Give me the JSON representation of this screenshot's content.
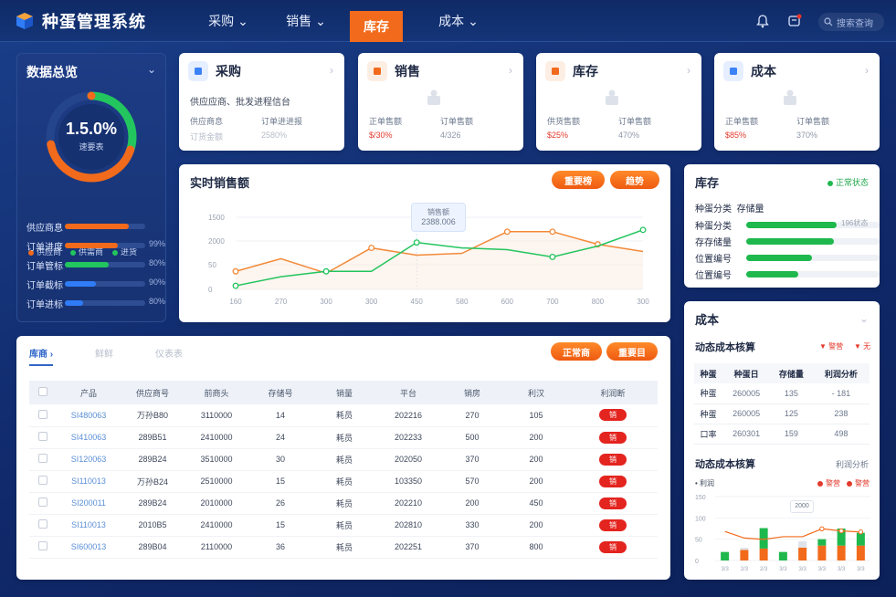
{
  "app": {
    "title": "种蛋管理系统"
  },
  "nav": [
    {
      "label": "采购"
    },
    {
      "label": "销售"
    },
    {
      "label": "库存"
    },
    {
      "label": "成本"
    }
  ],
  "search": {
    "placeholder": "搜索查询"
  },
  "overview": {
    "title": "数据总览",
    "gauge": {
      "value": "1.5.0%",
      "label": "速要表",
      "progress": 0.72
    },
    "legend": [
      {
        "label": "供应商",
        "color": "#f26a1b"
      },
      {
        "label": "供需商",
        "color": "#22c55e"
      },
      {
        "label": "进货",
        "color": "#22c55e"
      }
    ],
    "bars": [
      {
        "label": "供应商息",
        "pct": "",
        "fill": 0.8,
        "color": "#f26a1b"
      },
      {
        "label": "订单进度",
        "pct": "99%",
        "fill": 0.66,
        "color": "#f26a1b"
      },
      {
        "label": "订单管标",
        "pct": "80%",
        "fill": 0.54,
        "color": "#22c55e"
      },
      {
        "label": "订单截标",
        "pct": "90%",
        "fill": 0.39,
        "color": "#2f7cf6"
      },
      {
        "label": "订单进标",
        "pct": "80%",
        "fill": 0.23,
        "color": "#2f7cf6"
      }
    ]
  },
  "modules": [
    {
      "title": "采购",
      "desc": "供应应商、批发进程信台",
      "c1_label": "供应商息",
      "c1_value": "订货金额",
      "c2_label": "订单进进报",
      "c2_value": "2580%",
      "icon": "people-icon",
      "color": "#3b82f6",
      "iconbg": "#e6efff",
      "value_red": false
    },
    {
      "title": "销售",
      "desc": "",
      "c1_label": "正单售额",
      "c1_value": "$/30%",
      "c2_label": "订单售额",
      "c2_value": "4/326",
      "icon": "box-icon",
      "color": "#f26a1b",
      "iconbg": "#fdeee3",
      "value_red": true
    },
    {
      "title": "库存",
      "desc": "",
      "c1_label": "供货售额",
      "c1_value": "$25%",
      "c2_label": "订单售额",
      "c2_value": "470%",
      "icon": "warehouse-icon",
      "color": "#f26a1b",
      "iconbg": "#fdeee3",
      "value_red": true
    },
    {
      "title": "成本",
      "desc": "",
      "c1_label": "正单售额",
      "c1_value": "$85%",
      "c2_label": "订单售额",
      "c2_value": "370%",
      "icon": "grid-icon",
      "color": "#3b82f6",
      "iconbg": "#e6efff",
      "value_red": true
    }
  ],
  "sales_chart_card": {
    "title": "实时销售额",
    "btn1": "重要榜",
    "btn2": "趋势",
    "tooltip_title": "销售额",
    "tooltip_value": "2388.006"
  },
  "chart_data": {
    "type": "line",
    "x": [
      "160",
      "270",
      "300",
      "300",
      "450",
      "580",
      "600",
      "700",
      "800",
      "300"
    ],
    "yticks": [
      "1500",
      "2000",
      "50",
      "0"
    ],
    "series": [
      {
        "color": "#f28a3a",
        "values": [
          50,
          85,
          45,
          115,
          95,
          100,
          160,
          160,
          125,
          105
        ]
      },
      {
        "color": "#22c55e",
        "values": [
          10,
          35,
          50,
          50,
          130,
          115,
          110,
          90,
          120,
          165
        ]
      }
    ],
    "ylim": [
      0,
      200
    ],
    "grid": true
  },
  "inventory": {
    "title": "库存",
    "status": "正常状态",
    "header": {
      "a": "种蛋分类",
      "b": "存储量"
    },
    "rows": [
      {
        "label": "种蛋分类",
        "fill": 0.68,
        "value": "196状态"
      },
      {
        "label": "存存储量",
        "fill": 0.66,
        "value": ""
      },
      {
        "label": "位置编号",
        "fill": 0.49,
        "value": ""
      },
      {
        "label": "位置编号",
        "fill": 0.39,
        "value": ""
      }
    ]
  },
  "table_card": {
    "tabs": [
      "库商",
      "鲜鲜",
      "仪表表"
    ],
    "btn1": "正常商",
    "btn2": "重要目",
    "headers": [
      "产品",
      "供应商号",
      "前商头",
      "存储号",
      "销量",
      "平台",
      "销房",
      "利汉",
      "利润断"
    ],
    "rows": [
      [
        "SI480063",
        "万孙B80",
        "3110000",
        "14",
        "耗员",
        "202216",
        "270",
        "105",
        "销"
      ],
      [
        "SI410063",
        "289B51",
        "2410000",
        "24",
        "耗员",
        "202233",
        "500",
        "200",
        "销"
      ],
      [
        "SI120063",
        "289B24",
        "3510000",
        "30",
        "耗员",
        "202050",
        "370",
        "200",
        "销"
      ],
      [
        "SI110013",
        "万孙B24",
        "2510000",
        "15",
        "耗员",
        "103350",
        "570",
        "200",
        "销"
      ],
      [
        "SI200011",
        "289B24",
        "2010000",
        "26",
        "耗员",
        "202210",
        "200",
        "450",
        "销"
      ],
      [
        "SI110013",
        "2010B5",
        "2410000",
        "15",
        "耗员",
        "202810",
        "330",
        "200",
        "销"
      ],
      [
        "SI600013",
        "289B04",
        "2110000",
        "36",
        "耗员",
        "202251",
        "370",
        "800",
        "销"
      ]
    ]
  },
  "cost": {
    "title": "成本",
    "section1": "动态成本核算",
    "warn1": "警营",
    "warn2": "无",
    "table_headers": [
      "种蛋",
      "种蛋日",
      "存储量",
      "利润分析"
    ],
    "table_rows": [
      [
        "种蛋",
        "260005",
        "135",
        "- 181"
      ],
      [
        "种蛋",
        "260005",
        "125",
        "238"
      ],
      [
        "口率",
        "260301",
        "159",
        "498"
      ]
    ],
    "section2": "动态成本核算",
    "section2_right": "利润分析",
    "legend_left": "利润",
    "legend_a": "警营",
    "legend_b": "警营",
    "tooltip": "2000",
    "yticks": [
      "150",
      "100",
      "50",
      "0"
    ],
    "x": [
      "3/3",
      "2/3",
      "2/3",
      "3/3",
      "3/3",
      "3/3",
      "3/3",
      "3/3"
    ]
  },
  "cost_chart": {
    "type": "bar",
    "green": [
      20,
      0,
      48,
      20,
      0,
      15,
      40,
      30
    ],
    "orange": [
      0,
      25,
      28,
      0,
      30,
      35,
      35,
      35
    ],
    "gray": [
      0,
      5,
      0,
      0,
      15,
      0,
      0,
      0
    ],
    "line": [
      110,
      85,
      80,
      90,
      90,
      120,
      112,
      108
    ]
  }
}
